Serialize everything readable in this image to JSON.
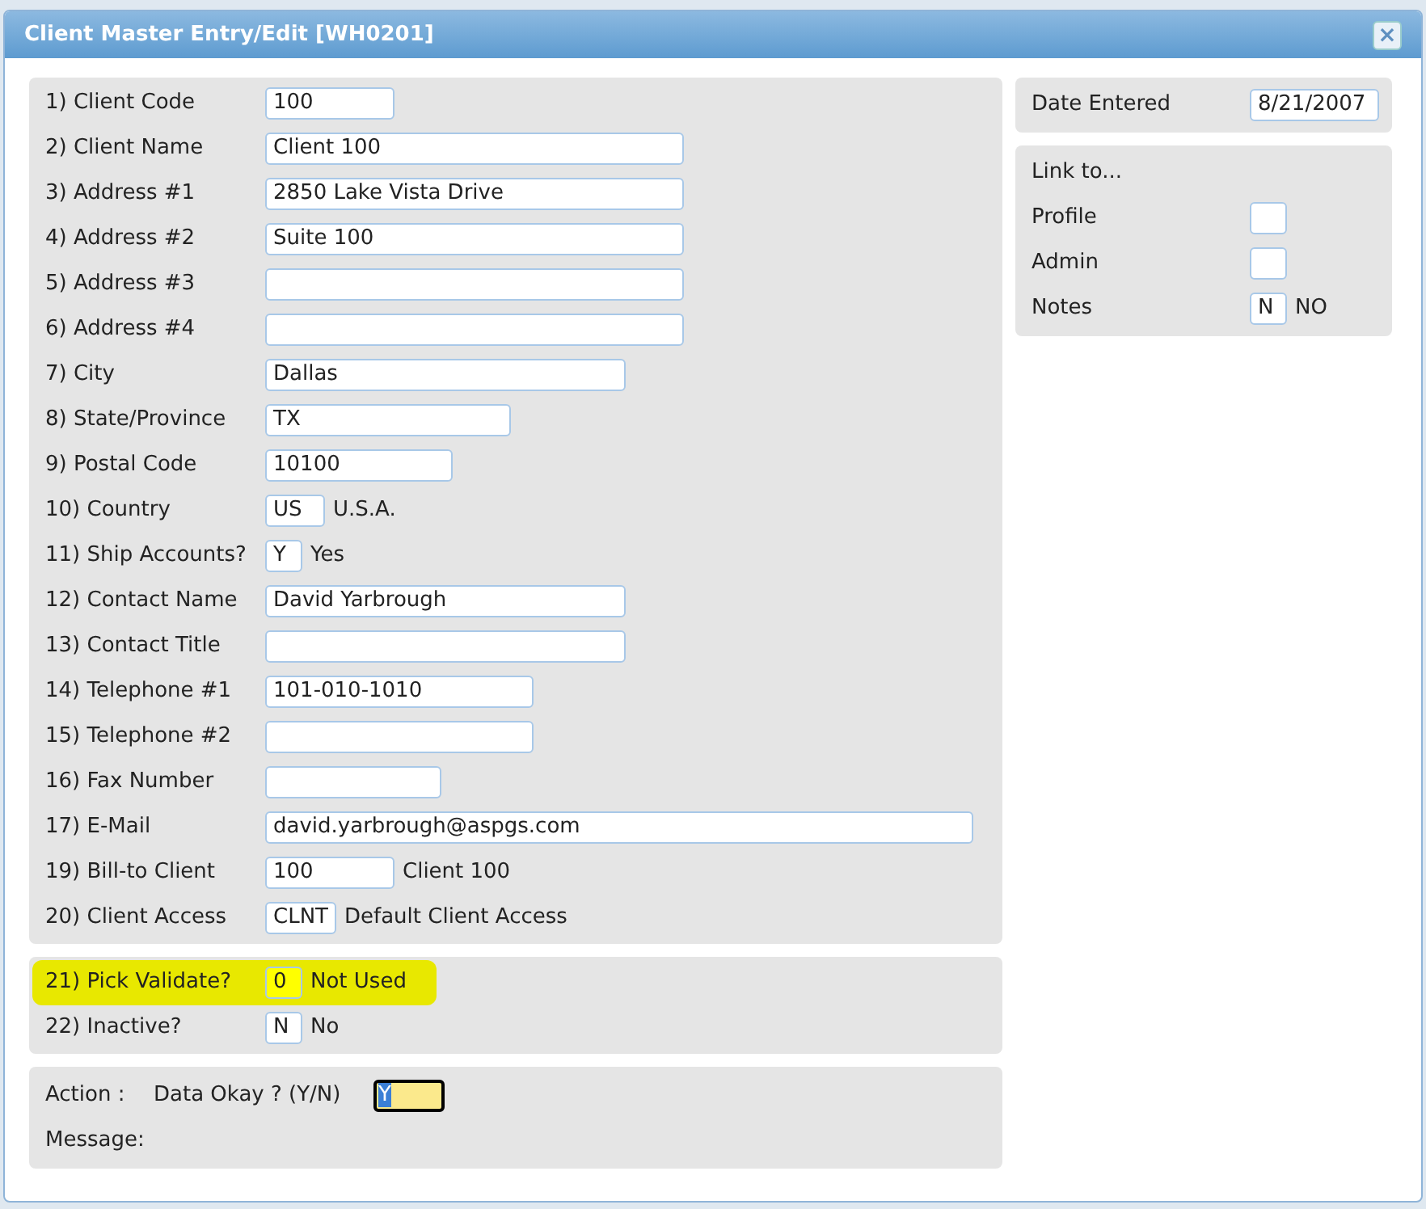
{
  "window": {
    "title": "Client Master Entry/Edit [WH0201]",
    "close": "×"
  },
  "main_fields": [
    {
      "label": "1) Client Code",
      "value": "100"
    },
    {
      "label": "2) Client Name",
      "value": "Client 100"
    },
    {
      "label": "3) Address #1",
      "value": "2850 Lake Vista Drive"
    },
    {
      "label": "4) Address #2",
      "value": "Suite 100"
    },
    {
      "label": "5) Address #3"
    },
    {
      "label": "6) Address #4"
    },
    {
      "label": "7) City",
      "value": "Dallas"
    },
    {
      "label": "8) State/Province",
      "value": "TX"
    },
    {
      "label": "9) Postal Code",
      "value": "10100"
    },
    {
      "label": "10) Country",
      "value": "US",
      "description": "U.S.A."
    },
    {
      "label": "11) Ship Accounts?",
      "value": "Y",
      "description": "Yes"
    },
    {
      "label": "12) Contact Name",
      "value": "David Yarbrough"
    },
    {
      "label": "13) Contact Title"
    },
    {
      "label": "14) Telephone #1",
      "value": "101-010-1010"
    },
    {
      "label": "15) Telephone #2"
    },
    {
      "label": "16) Fax Number"
    },
    {
      "label": "17) E-Mail",
      "value": "david.yarbrough@aspgs.com"
    },
    {
      "label": "19) Bill-to Client",
      "value": "100",
      "description": "Client 100"
    },
    {
      "label": "20) Client Access",
      "value": "CLNT",
      "description": "Default Client Access"
    }
  ],
  "options": [
    {
      "label": "21) Pick Validate?",
      "value": "0",
      "description": "Not Used",
      "highlighted": true
    },
    {
      "label": "22) Inactive?",
      "value": "N",
      "description": "No",
      "highlighted": false
    }
  ],
  "action": {
    "label": "Action :",
    "prompt": "Data Okay ? (Y/N)",
    "value": "Y",
    "message_label": "Message:"
  },
  "date_entered": {
    "label": "Date Entered",
    "value": "8/21/2007"
  },
  "link_to": {
    "title": "Link to...",
    "items": [
      {
        "label": "Profile"
      },
      {
        "label": "Admin"
      },
      {
        "label": "Notes",
        "value": "N",
        "description": "NO"
      }
    ]
  }
}
